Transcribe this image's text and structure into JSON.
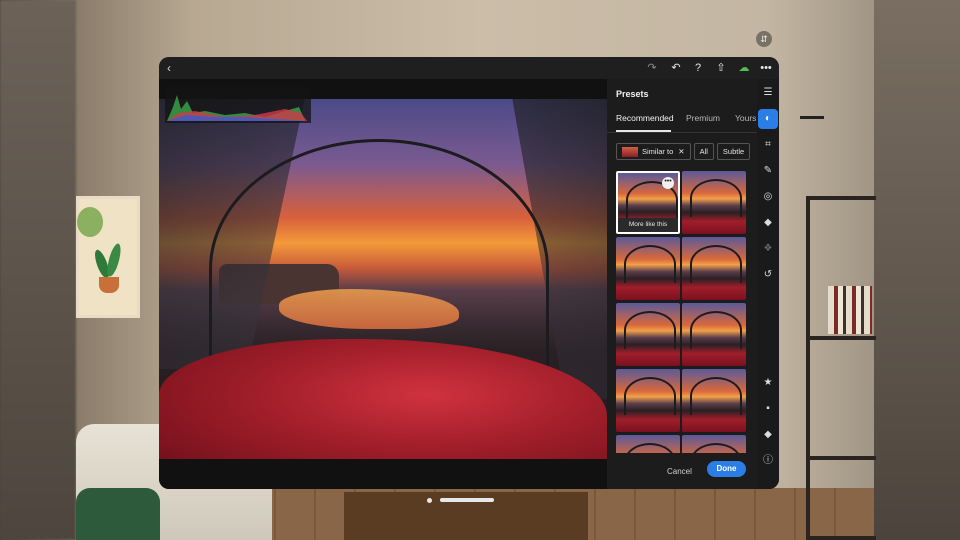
{
  "panel": {
    "title": "Presets",
    "tabs": [
      {
        "label": "Recommended",
        "active": true
      },
      {
        "label": "Premium",
        "active": false
      },
      {
        "label": "Yours",
        "active": false
      }
    ],
    "filters": [
      {
        "label": "Similar to",
        "removable": true
      },
      {
        "label": "All",
        "removable": false
      },
      {
        "label": "Subtle",
        "removable": false
      }
    ],
    "thumbnails": {
      "selected_overlay": "More like this",
      "more_glyph": "•••"
    },
    "footer": {
      "cancel_label": "Cancel",
      "done_label": "Done"
    }
  },
  "topbar": {
    "back_icon": "chevron-left-icon",
    "icons": [
      "redo-icon",
      "undo-icon",
      "help-icon",
      "share-icon",
      "cloud-sync-icon",
      "more-icon"
    ]
  },
  "toolstrip": {
    "tools": [
      "edit-sliders-icon",
      "presets-icon",
      "crop-icon",
      "brush-icon",
      "masking-icon",
      "healing-icon",
      "versions-icon",
      "history-icon",
      "star-icon",
      "comment-icon",
      "tag-icon",
      "info-icon"
    ],
    "active_tool": "presets-icon"
  },
  "colors": {
    "accent": "#2a7ee6",
    "panel_bg": "#1c1c1c",
    "app_bg": "#1a1a1a"
  }
}
